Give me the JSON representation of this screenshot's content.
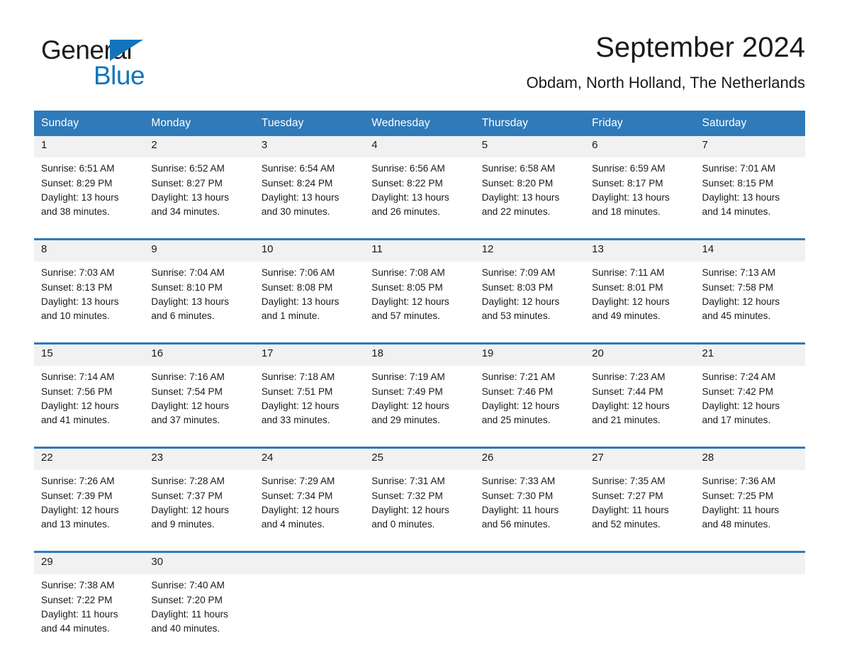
{
  "brand": {
    "name_part1": "General",
    "name_part2": "Blue",
    "accent_color": "#1275bc"
  },
  "header": {
    "title": "September 2024",
    "subtitle": "Obdam, North Holland, The Netherlands"
  },
  "calendar": {
    "header_color": "#2f7ab8",
    "weekday_headers": [
      "Sunday",
      "Monday",
      "Tuesday",
      "Wednesday",
      "Thursday",
      "Friday",
      "Saturday"
    ],
    "weeks": [
      [
        {
          "day": "1",
          "sunrise": "Sunrise: 6:51 AM",
          "sunset": "Sunset: 8:29 PM",
          "daylight_1": "Daylight: 13 hours",
          "daylight_2": "and 38 minutes."
        },
        {
          "day": "2",
          "sunrise": "Sunrise: 6:52 AM",
          "sunset": "Sunset: 8:27 PM",
          "daylight_1": "Daylight: 13 hours",
          "daylight_2": "and 34 minutes."
        },
        {
          "day": "3",
          "sunrise": "Sunrise: 6:54 AM",
          "sunset": "Sunset: 8:24 PM",
          "daylight_1": "Daylight: 13 hours",
          "daylight_2": "and 30 minutes."
        },
        {
          "day": "4",
          "sunrise": "Sunrise: 6:56 AM",
          "sunset": "Sunset: 8:22 PM",
          "daylight_1": "Daylight: 13 hours",
          "daylight_2": "and 26 minutes."
        },
        {
          "day": "5",
          "sunrise": "Sunrise: 6:58 AM",
          "sunset": "Sunset: 8:20 PM",
          "daylight_1": "Daylight: 13 hours",
          "daylight_2": "and 22 minutes."
        },
        {
          "day": "6",
          "sunrise": "Sunrise: 6:59 AM",
          "sunset": "Sunset: 8:17 PM",
          "daylight_1": "Daylight: 13 hours",
          "daylight_2": "and 18 minutes."
        },
        {
          "day": "7",
          "sunrise": "Sunrise: 7:01 AM",
          "sunset": "Sunset: 8:15 PM",
          "daylight_1": "Daylight: 13 hours",
          "daylight_2": "and 14 minutes."
        }
      ],
      [
        {
          "day": "8",
          "sunrise": "Sunrise: 7:03 AM",
          "sunset": "Sunset: 8:13 PM",
          "daylight_1": "Daylight: 13 hours",
          "daylight_2": "and 10 minutes."
        },
        {
          "day": "9",
          "sunrise": "Sunrise: 7:04 AM",
          "sunset": "Sunset: 8:10 PM",
          "daylight_1": "Daylight: 13 hours",
          "daylight_2": "and 6 minutes."
        },
        {
          "day": "10",
          "sunrise": "Sunrise: 7:06 AM",
          "sunset": "Sunset: 8:08 PM",
          "daylight_1": "Daylight: 13 hours",
          "daylight_2": "and 1 minute."
        },
        {
          "day": "11",
          "sunrise": "Sunrise: 7:08 AM",
          "sunset": "Sunset: 8:05 PM",
          "daylight_1": "Daylight: 12 hours",
          "daylight_2": "and 57 minutes."
        },
        {
          "day": "12",
          "sunrise": "Sunrise: 7:09 AM",
          "sunset": "Sunset: 8:03 PM",
          "daylight_1": "Daylight: 12 hours",
          "daylight_2": "and 53 minutes."
        },
        {
          "day": "13",
          "sunrise": "Sunrise: 7:11 AM",
          "sunset": "Sunset: 8:01 PM",
          "daylight_1": "Daylight: 12 hours",
          "daylight_2": "and 49 minutes."
        },
        {
          "day": "14",
          "sunrise": "Sunrise: 7:13 AM",
          "sunset": "Sunset: 7:58 PM",
          "daylight_1": "Daylight: 12 hours",
          "daylight_2": "and 45 minutes."
        }
      ],
      [
        {
          "day": "15",
          "sunrise": "Sunrise: 7:14 AM",
          "sunset": "Sunset: 7:56 PM",
          "daylight_1": "Daylight: 12 hours",
          "daylight_2": "and 41 minutes."
        },
        {
          "day": "16",
          "sunrise": "Sunrise: 7:16 AM",
          "sunset": "Sunset: 7:54 PM",
          "daylight_1": "Daylight: 12 hours",
          "daylight_2": "and 37 minutes."
        },
        {
          "day": "17",
          "sunrise": "Sunrise: 7:18 AM",
          "sunset": "Sunset: 7:51 PM",
          "daylight_1": "Daylight: 12 hours",
          "daylight_2": "and 33 minutes."
        },
        {
          "day": "18",
          "sunrise": "Sunrise: 7:19 AM",
          "sunset": "Sunset: 7:49 PM",
          "daylight_1": "Daylight: 12 hours",
          "daylight_2": "and 29 minutes."
        },
        {
          "day": "19",
          "sunrise": "Sunrise: 7:21 AM",
          "sunset": "Sunset: 7:46 PM",
          "daylight_1": "Daylight: 12 hours",
          "daylight_2": "and 25 minutes."
        },
        {
          "day": "20",
          "sunrise": "Sunrise: 7:23 AM",
          "sunset": "Sunset: 7:44 PM",
          "daylight_1": "Daylight: 12 hours",
          "daylight_2": "and 21 minutes."
        },
        {
          "day": "21",
          "sunrise": "Sunrise: 7:24 AM",
          "sunset": "Sunset: 7:42 PM",
          "daylight_1": "Daylight: 12 hours",
          "daylight_2": "and 17 minutes."
        }
      ],
      [
        {
          "day": "22",
          "sunrise": "Sunrise: 7:26 AM",
          "sunset": "Sunset: 7:39 PM",
          "daylight_1": "Daylight: 12 hours",
          "daylight_2": "and 13 minutes."
        },
        {
          "day": "23",
          "sunrise": "Sunrise: 7:28 AM",
          "sunset": "Sunset: 7:37 PM",
          "daylight_1": "Daylight: 12 hours",
          "daylight_2": "and 9 minutes."
        },
        {
          "day": "24",
          "sunrise": "Sunrise: 7:29 AM",
          "sunset": "Sunset: 7:34 PM",
          "daylight_1": "Daylight: 12 hours",
          "daylight_2": "and 4 minutes."
        },
        {
          "day": "25",
          "sunrise": "Sunrise: 7:31 AM",
          "sunset": "Sunset: 7:32 PM",
          "daylight_1": "Daylight: 12 hours",
          "daylight_2": "and 0 minutes."
        },
        {
          "day": "26",
          "sunrise": "Sunrise: 7:33 AM",
          "sunset": "Sunset: 7:30 PM",
          "daylight_1": "Daylight: 11 hours",
          "daylight_2": "and 56 minutes."
        },
        {
          "day": "27",
          "sunrise": "Sunrise: 7:35 AM",
          "sunset": "Sunset: 7:27 PM",
          "daylight_1": "Daylight: 11 hours",
          "daylight_2": "and 52 minutes."
        },
        {
          "day": "28",
          "sunrise": "Sunrise: 7:36 AM",
          "sunset": "Sunset: 7:25 PM",
          "daylight_1": "Daylight: 11 hours",
          "daylight_2": "and 48 minutes."
        }
      ],
      [
        {
          "day": "29",
          "sunrise": "Sunrise: 7:38 AM",
          "sunset": "Sunset: 7:22 PM",
          "daylight_1": "Daylight: 11 hours",
          "daylight_2": "and 44 minutes."
        },
        {
          "day": "30",
          "sunrise": "Sunrise: 7:40 AM",
          "sunset": "Sunset: 7:20 PM",
          "daylight_1": "Daylight: 11 hours",
          "daylight_2": "and 40 minutes."
        },
        {
          "day": "",
          "sunrise": "",
          "sunset": "",
          "daylight_1": "",
          "daylight_2": ""
        },
        {
          "day": "",
          "sunrise": "",
          "sunset": "",
          "daylight_1": "",
          "daylight_2": ""
        },
        {
          "day": "",
          "sunrise": "",
          "sunset": "",
          "daylight_1": "",
          "daylight_2": ""
        },
        {
          "day": "",
          "sunrise": "",
          "sunset": "",
          "daylight_1": "",
          "daylight_2": ""
        },
        {
          "day": "",
          "sunrise": "",
          "sunset": "",
          "daylight_1": "",
          "daylight_2": ""
        }
      ]
    ]
  }
}
